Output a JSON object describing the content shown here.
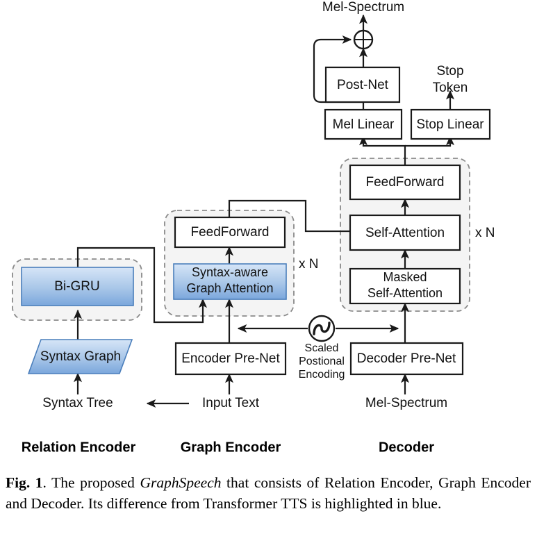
{
  "figure": {
    "title_node": "Mel-Spectrum",
    "colors": {
      "blue_top": "#cfe0f5",
      "blue_bottom": "#7fa9dd",
      "blue_stroke": "#4a7ebb",
      "box_stroke": "#1a1a1a",
      "dashed_stroke": "#8a8a8a",
      "dashed_fill": "#f4f4f4",
      "line": "#1a1a1a"
    },
    "boxes": {
      "post_net": "Post-Net",
      "mel_linear": "Mel Linear",
      "stop_linear": "Stop Linear",
      "decoder_feedforward": "FeedForward",
      "self_attention": "Self-Attention",
      "masked_self_attention_l1": "Masked",
      "masked_self_attention_l2": "Self-Attention",
      "decoder_prenet": "Decoder Pre-Net",
      "encoder_prenet": "Encoder Pre-Net",
      "graph_feedforward": "FeedForward",
      "syntax_attention_l1": "Syntax-aware",
      "syntax_attention_l2": "Graph Attention",
      "bi_gru": "Bi-GRU",
      "syntax_graph": "Syntax Graph"
    },
    "io_labels": {
      "mel_spectrum_out": "Mel-Spectrum",
      "stop_token_l1": "Stop",
      "stop_token_l2": "Token",
      "syntax_tree": "Syntax Tree",
      "input_text": "Input Text",
      "mel_spectrum_in": "Mel-Spectrum"
    },
    "positional_encoding": {
      "line1": "Scaled",
      "line2": "Postional",
      "line3": "Encoding",
      "icon": "sine-wave-icon"
    },
    "repeat_labels": {
      "graph_encoder": "x N",
      "decoder": "x N"
    },
    "add_operator": "⊕",
    "group_labels": {
      "relation_encoder": "Relation Encoder",
      "graph_encoder": "Graph Encoder",
      "decoder": "Decoder"
    }
  },
  "caption": {
    "fig_number": "Fig. 1",
    "text_1": ". The proposed ",
    "emphasis": "GraphSpeech",
    "text_2": " that consists of Relation Encoder, Graph Encoder and Decoder.  Its difference from Transformer TTS is highlighted in blue."
  }
}
